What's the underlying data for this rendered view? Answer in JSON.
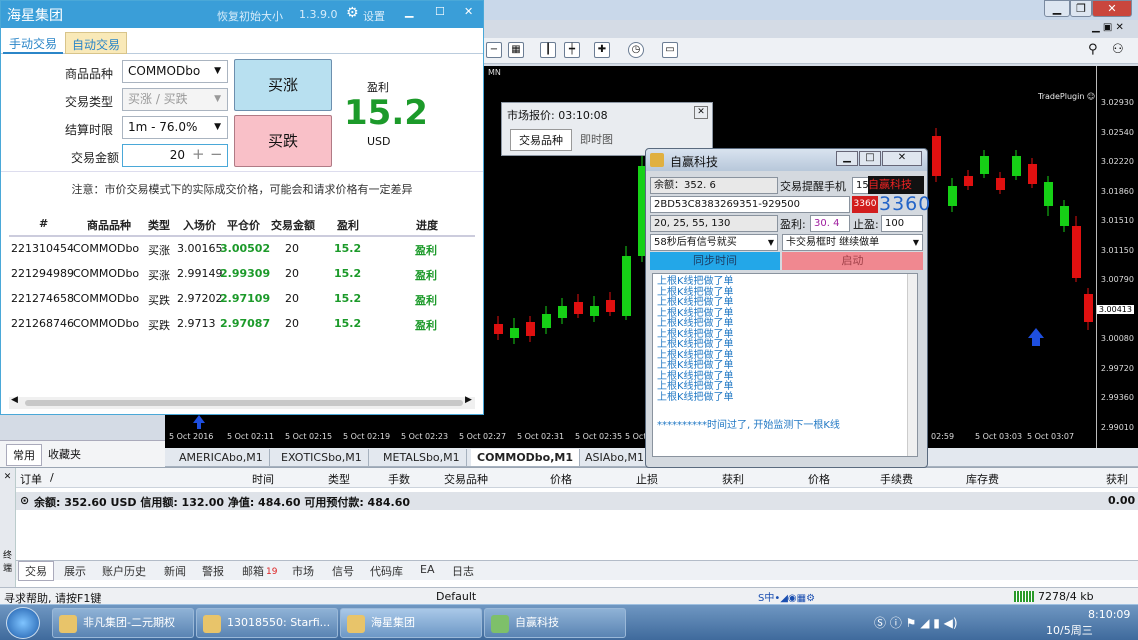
{
  "mt4": {
    "toolbar_icons": [
      "zoom-out-icon",
      "tile-icon",
      "period-sep-icon",
      "bar-chart-icon",
      "indicator-icon",
      "clock-icon",
      "template-icon"
    ],
    "tradeplugin_label": "TradePlugin ☺",
    "price_labels": [
      "3.02930",
      "3.02540",
      "3.02220",
      "3.01860",
      "3.01510",
      "3.01150",
      "3.00790",
      "3.00413",
      "3.00080",
      "2.99720",
      "2.99360",
      "2.99010"
    ],
    "time_labels": [
      "5 Oct 2016",
      "5 Oct 02:11",
      "5 Oct 02:15",
      "5 Oct 02:19",
      "5 Oct 02:23",
      "5 Oct 02:27",
      "5 Oct 02:31",
      "5 Oct 02:35",
      "5 Oct 02",
      "02:59",
      "5 Oct 03:03",
      "5 Oct 03:07"
    ],
    "symbol_tabs": [
      "AMERICAbo,M1",
      "EXOTICSbo,M1",
      "METALSbo,M1",
      "COMMODbo,M1",
      "ASIAbo,M1"
    ],
    "mn_label": "MN",
    "left_tabs": [
      "常用",
      "收藏夹"
    ],
    "terminal": {
      "headers": [
        "订单",
        "/",
        "时间",
        "类型",
        "手数",
        "交易品种",
        "价格",
        "止损",
        "获利",
        "价格",
        "手续费",
        "库存费",
        "获利"
      ],
      "balance_text": "余额: 352.60 USD  信用额: 132.00  净值: 484.60  可用预付款: 484.60",
      "balance_total": "0.00",
      "tabs": [
        "交易",
        "展示",
        "账户历史",
        "新闻",
        "警报",
        "邮箱",
        "市场",
        "信号",
        "代码库",
        "EA",
        "日志"
      ],
      "mail_count": "19",
      "side_label": "终端"
    },
    "status": {
      "help": "寻求帮助, 请按F1键",
      "profile": "Default",
      "traffic": "7278/4 kb"
    }
  },
  "hx": {
    "title": "海星集团",
    "restore_label": "恢复初始大小",
    "version": "1.3.9.0",
    "settings_label": "设置",
    "tabs": [
      "手动交易",
      "自动交易"
    ],
    "symbol_label": "商品品种",
    "symbol_value": "COMMODbo",
    "type_label": "交易类型",
    "type_value": "买涨 / 买跌",
    "settle_label": "结算时限",
    "settle_value": "1m - 76.0%",
    "amount_label": "交易金额",
    "amount_value": "20",
    "buy_label": "买涨",
    "sell_label": "买跌",
    "profit_label": "盈利",
    "profit_value": "15.2",
    "profit_unit": "USD",
    "notice": "注意：市价交易模式下的实际成交价格，可能会和请求价格有一定差异",
    "columns": [
      "#",
      "商品品种",
      "类型",
      "入场价",
      "平仓价",
      "交易金额",
      "盈利",
      "进度"
    ],
    "rows": [
      {
        "id": "221310454",
        "symbol": "COMMODbo",
        "type": "买涨",
        "entry": "3.00165",
        "close": "3.00502",
        "amount": "20",
        "profit": "15.2",
        "status": "盈利"
      },
      {
        "id": "221294989",
        "symbol": "COMMODbo",
        "type": "买涨",
        "entry": "2.99149",
        "close": "2.99309",
        "amount": "20",
        "profit": "15.2",
        "status": "盈利"
      },
      {
        "id": "221274658",
        "symbol": "COMMODbo",
        "type": "买跌",
        "entry": "2.97202",
        "close": "2.97109",
        "amount": "20",
        "profit": "15.2",
        "status": "盈利"
      },
      {
        "id": "221268746",
        "symbol": "COMMODbo",
        "type": "买跌",
        "entry": "2.9713",
        "close": "2.97087",
        "amount": "20",
        "profit": "15.2",
        "status": "盈利"
      }
    ]
  },
  "mq": {
    "title": "市场报价: 03:10:08",
    "tabs": [
      "交易品种",
      "即时图"
    ]
  },
  "zy": {
    "title": "自赢科技",
    "balance": "余额：352. 6",
    "remind_label": "交易提醒手机",
    "remind_value": "150",
    "brand": "自赢科技",
    "code": "2BD53C8383269351-929500",
    "code_red": "3360",
    "big_num": "3360",
    "seq": "20, 25, 55, 130",
    "profit_label": "盈利:",
    "profit_value": "30. 4",
    "tp_label": "止盈:",
    "tp_value": "100",
    "signal_select": "58秒后有信号就买",
    "mode_select": "卡交易框时 继续做单",
    "sync_btn": "同步时间",
    "start_btn": "启动",
    "log_line": "上根K线把做了单",
    "log_final": "**********时间过了, 开始监测下一根K线"
  },
  "taskbar": {
    "items": [
      "非凡集团-二元期权",
      "13018550: Starfi...",
      "海星集团",
      "自赢科技"
    ],
    "clock": "8:10:09",
    "date": "10/5周三"
  },
  "colors": {
    "bull": "#16d016",
    "bear": "#e01010",
    "accent": "#3a9ed8",
    "profit": "#1c9a2a"
  }
}
